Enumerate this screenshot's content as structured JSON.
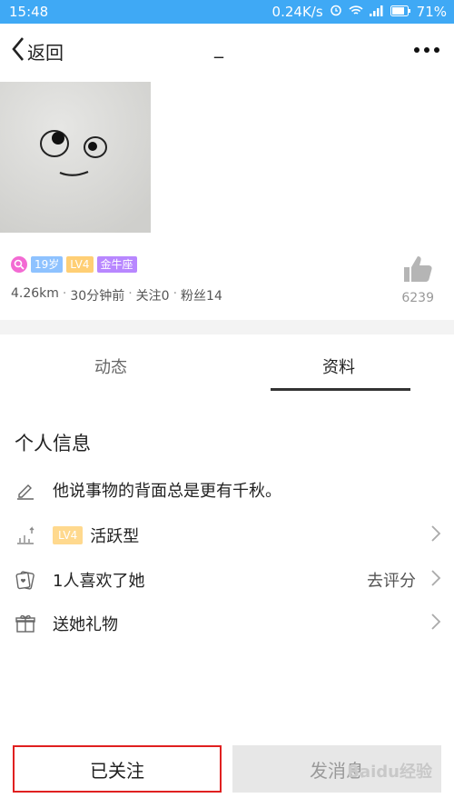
{
  "status_bar": {
    "time": "15:48",
    "speed": "0.24K/s",
    "battery": "71%",
    "icons": [
      "alarm-icon",
      "wifi-icon",
      "signal-icon",
      "battery-icon"
    ]
  },
  "nav": {
    "back_label": "返回",
    "title": "_"
  },
  "profile": {
    "tags": {
      "age": "19岁",
      "level": "LV4",
      "zodiac": "金牛座"
    },
    "meta": {
      "distance": "4.26km",
      "time_ago": "30分钟前",
      "following": "关注0",
      "fans": "粉丝14",
      "sep": "·"
    },
    "likes": "6239"
  },
  "tabs": {
    "posts": "动态",
    "info": "资料",
    "active": "info"
  },
  "info": {
    "title": "个人信息",
    "rows": [
      {
        "icon": "pencil-icon",
        "text": "他说事物的背面总是更有千秋。"
      },
      {
        "icon": "activity-icon",
        "badge": "LV4",
        "text": "活跃型"
      },
      {
        "icon": "like-card-icon",
        "text": "1人喜欢了她",
        "extra": "去评分"
      },
      {
        "icon": "gift-icon",
        "text": "送她礼物"
      }
    ]
  },
  "actions": {
    "follow": "已关注",
    "message": "发消息"
  },
  "watermark": "Baidu经验",
  "colors": {
    "status_bar": "#3fa9f5",
    "follow_border": "#e02020",
    "zodiac_tag": "#b887ff",
    "age_tag": "#8ec2ff",
    "level_tag": "#ffcf75"
  }
}
